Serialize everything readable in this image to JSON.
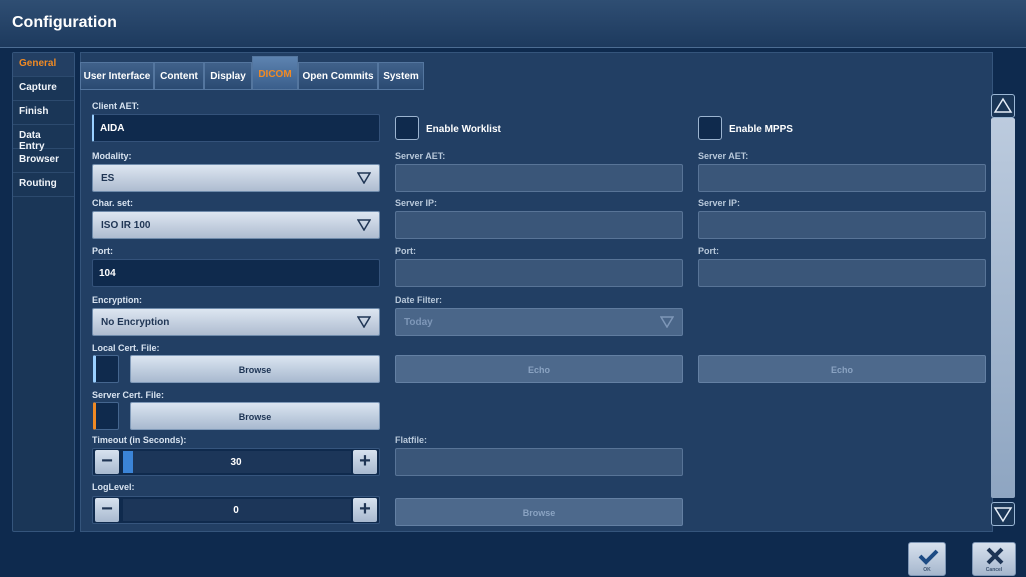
{
  "window": {
    "title": "Configuration"
  },
  "sidebar": {
    "items": [
      {
        "label": "General",
        "active": true
      },
      {
        "label": "Capture"
      },
      {
        "label": "Finish"
      },
      {
        "label": "Data Entry"
      },
      {
        "label": "Browser"
      },
      {
        "label": "Routing"
      }
    ]
  },
  "tabs": [
    {
      "label": "User Interface"
    },
    {
      "label": "Content"
    },
    {
      "label": "Display"
    },
    {
      "label": "DICOM",
      "active": true
    },
    {
      "label": "Open Commits"
    },
    {
      "label": "System"
    }
  ],
  "left": {
    "client_aet": {
      "label": "Client AET:",
      "value": "AIDA"
    },
    "modality": {
      "label": "Modality:",
      "value": "ES"
    },
    "charset": {
      "label": "Char. set:",
      "value": "ISO IR 100"
    },
    "port": {
      "label": "Port:",
      "value": "104"
    },
    "encryption": {
      "label": "Encryption:",
      "value": "No Encryption"
    },
    "local_cert": {
      "label": "Local Cert. File:",
      "button": "Browse"
    },
    "server_cert": {
      "label": "Server Cert. File:",
      "button": "Browse"
    },
    "timeout": {
      "label": "Timeout (in Seconds):",
      "value": "30"
    },
    "loglevel": {
      "label": "LogLevel:",
      "value": "0"
    }
  },
  "worklist": {
    "enable_label": "Enable Worklist",
    "server_aet_label": "Server AET:",
    "server_ip_label": "Server IP:",
    "port_label": "Port:",
    "date_filter_label": "Date Filter:",
    "date_filter_value": "Today",
    "echo_button": "Echo",
    "flatfile_label": "Flatfile:",
    "browse_button": "Browse"
  },
  "mpps": {
    "enable_label": "Enable MPPS",
    "server_aet_label": "Server AET:",
    "server_ip_label": "Server IP:",
    "port_label": "Port:",
    "echo_button": "Echo"
  },
  "footer": {
    "ok_label": "OK",
    "cancel_label": "Cancel"
  },
  "colors": {
    "accent": "#f08a24",
    "background": "#0e2a4e",
    "panel": "#223f64"
  }
}
